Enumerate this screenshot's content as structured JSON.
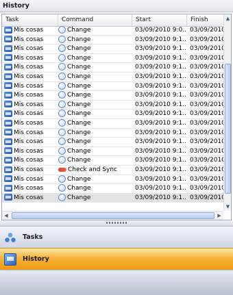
{
  "panel": {
    "title": "History"
  },
  "columns": {
    "task": "Task",
    "command": "Command",
    "start": "Start",
    "finish": "Finish"
  },
  "rows": [
    {
      "task": "Mis cosas",
      "command": "Change",
      "start": "03/09/2010 9:0...",
      "finish": "03/09/2010",
      "icon": "change-icon"
    },
    {
      "task": "Mis cosas",
      "command": "Change",
      "start": "03/09/2010 9:1...",
      "finish": "03/09/2010",
      "icon": "change-icon"
    },
    {
      "task": "Mis cosas",
      "command": "Change",
      "start": "03/09/2010 9:1...",
      "finish": "03/09/2010",
      "icon": "change-icon"
    },
    {
      "task": "Mis cosas",
      "command": "Change",
      "start": "03/09/2010 9:1...",
      "finish": "03/09/2010",
      "icon": "change-icon"
    },
    {
      "task": "Mis cosas",
      "command": "Change",
      "start": "03/09/2010 9:1...",
      "finish": "03/09/2010",
      "icon": "change-icon"
    },
    {
      "task": "Mis cosas",
      "command": "Change",
      "start": "03/09/2010 9:1...",
      "finish": "03/09/2010",
      "icon": "change-icon"
    },
    {
      "task": "Mis cosas",
      "command": "Change",
      "start": "03/09/2010 9:1...",
      "finish": "03/09/2010",
      "icon": "change-icon"
    },
    {
      "task": "Mis cosas",
      "command": "Change",
      "start": "03/09/2010 9:1...",
      "finish": "03/09/2010",
      "icon": "change-icon"
    },
    {
      "task": "Mis cosas",
      "command": "Change",
      "start": "03/09/2010 9:1...",
      "finish": "03/09/2010",
      "icon": "change-icon"
    },
    {
      "task": "Mis cosas",
      "command": "Change",
      "start": "03/09/2010 9:1...",
      "finish": "03/09/2010",
      "icon": "change-icon"
    },
    {
      "task": "Mis cosas",
      "command": "Change",
      "start": "03/09/2010 9:1...",
      "finish": "03/09/2010",
      "icon": "change-icon"
    },
    {
      "task": "Mis cosas",
      "command": "Change",
      "start": "03/09/2010 9:1...",
      "finish": "03/09/2010",
      "icon": "change-icon"
    },
    {
      "task": "Mis cosas",
      "command": "Change",
      "start": "03/09/2010 9:1...",
      "finish": "03/09/2010",
      "icon": "change-icon"
    },
    {
      "task": "Mis cosas",
      "command": "Change",
      "start": "03/09/2010 9:1...",
      "finish": "03/09/2010",
      "icon": "change-icon"
    },
    {
      "task": "Mis cosas",
      "command": "Change",
      "start": "03/09/2010 9:1...",
      "finish": "03/09/2010",
      "icon": "change-icon"
    },
    {
      "task": "Mis cosas",
      "command": "Check and Sync",
      "start": "03/09/2010 9:1...",
      "finish": "03/09/2010",
      "icon": "sync-icon"
    },
    {
      "task": "Mis cosas",
      "command": "Change",
      "start": "03/09/2010 9:1...",
      "finish": "03/09/2010",
      "icon": "change-icon"
    },
    {
      "task": "Mis cosas",
      "command": "Change",
      "start": "03/09/2010 9:1...",
      "finish": "03/09/2010",
      "icon": "change-icon"
    },
    {
      "task": "Mis cosas",
      "command": "Change",
      "start": "03/09/2010 9:1...",
      "finish": "03/09/2010",
      "icon": "change-icon",
      "selected": true
    }
  ],
  "nav": {
    "tasks_label": "Tasks",
    "history_label": "History"
  }
}
